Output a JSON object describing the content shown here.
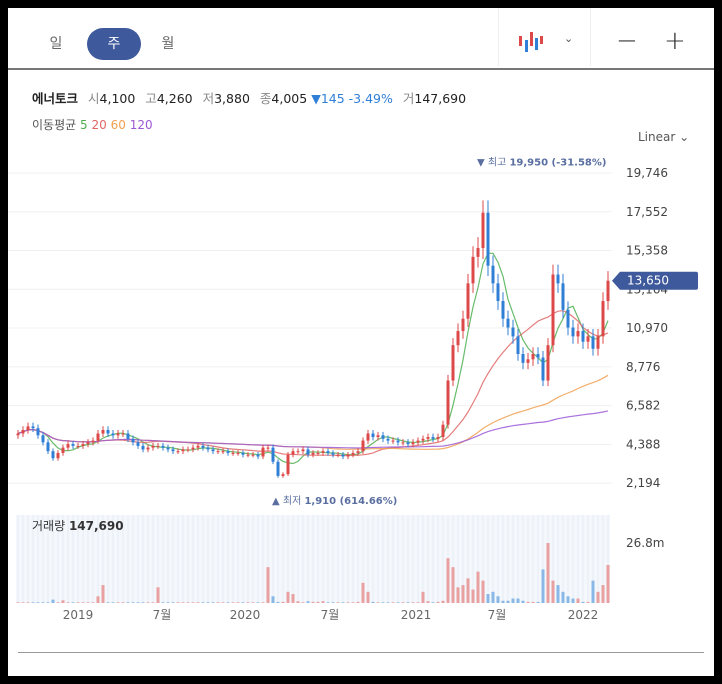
{
  "toolbar": {
    "periods": [
      "일",
      "주",
      "월"
    ],
    "active_period": "주",
    "chart_type_icon": "candlestick-icon",
    "zoom_out": "−",
    "zoom_in": "+"
  },
  "stock": {
    "name": "에너토크",
    "open_label": "시",
    "open": "4,100",
    "high_label": "고",
    "high": "4,260",
    "low_label": "저",
    "low": "3,880",
    "close_label": "종",
    "close": "4,005",
    "change_arrow": "▼",
    "change": "145",
    "change_pct": "-3.49%",
    "volume_label": "거",
    "volume": "147,690"
  },
  "moving_avg": {
    "label": "이동평균",
    "periods": [
      "5",
      "20",
      "60",
      "120"
    ],
    "colors": [
      "#4caf50",
      "#e06666",
      "#f0a050",
      "#9b59d6"
    ]
  },
  "scale_mode": "Linear",
  "colors": {
    "up": "#dd4848",
    "down": "#2f7fd6",
    "up_volume": "#e8a0a0",
    "down_volume": "#8ab8e6",
    "price_tag": "#3f5a9c",
    "annotation": "#5a6fa0"
  },
  "chart_data": {
    "type": "candlestick",
    "price_ticks": [
      "19,746",
      "17,552",
      "15,358",
      "13,164",
      "10,970",
      "8,776",
      "6,582",
      "4,388",
      "2,194"
    ],
    "price_tick_values": [
      19746,
      17552,
      15358,
      13164,
      10970,
      8776,
      6582,
      4388,
      2194
    ],
    "ylim": [
      670,
      21050
    ],
    "current_price": "13,650",
    "max_annotation": {
      "marker": "▼",
      "label": "최고",
      "value": "19,950 (-31.58%)",
      "price": 19950,
      "index": 93
    },
    "min_annotation": {
      "marker": "▲",
      "label": "최저",
      "value": "1,910 (614.66%)",
      "price": 1910,
      "index": 52
    },
    "x_ticks": [
      {
        "label": "2019",
        "index": 12
      },
      {
        "label": "7월",
        "index": 28.8
      },
      {
        "label": "2020",
        "index": 45.4
      },
      {
        "label": "7월",
        "index": 62.4
      },
      {
        "label": "2021",
        "index": 79.6
      },
      {
        "label": "7월",
        "index": 95.8
      },
      {
        "label": "2022",
        "index": 113
      }
    ],
    "closes": [
      5000,
      5200,
      5400,
      5300,
      4900,
      4500,
      4000,
      3600,
      3900,
      4200,
      4400,
      4300,
      4300,
      4400,
      4500,
      4600,
      5000,
      5200,
      5000,
      4900,
      5000,
      5000,
      4700,
      4500,
      4300,
      4100,
      4200,
      4300,
      4300,
      4200,
      4100,
      4000,
      4000,
      4100,
      4100,
      4200,
      4300,
      4200,
      4100,
      4000,
      4000,
      4000,
      3900,
      3900,
      3900,
      3800,
      3800,
      3800,
      3700,
      4200,
      4200,
      3400,
      2600,
      2700,
      3800,
      4000,
      4000,
      4100,
      3800,
      3900,
      3900,
      4000,
      3900,
      3800,
      3800,
      3700,
      3800,
      3900,
      4000,
      4600,
      5000,
      4800,
      4900,
      4700,
      4600,
      4600,
      4500,
      4500,
      4400,
      4500,
      4600,
      4700,
      4800,
      4700,
      4800,
      5500,
      8000,
      10000,
      10800,
      11500,
      13500,
      15000,
      15500,
      17500,
      14500,
      13500,
      12500,
      11500,
      11000,
      10500,
      9500,
      9000,
      9200,
      9500,
      9300,
      8000,
      10000,
      14000,
      13500,
      12000,
      11000,
      10500,
      10800,
      10200,
      10500,
      9800,
      10500,
      12500,
      13650
    ],
    "volume": {
      "label": "거래량",
      "value": "147,690",
      "tick": "26.8m",
      "max": 39.3,
      "values_m": [
        0.3,
        0.3,
        0.3,
        0.3,
        0.3,
        0.3,
        0.3,
        1.5,
        0.3,
        1.2,
        0.3,
        0.3,
        0.3,
        0.3,
        0.3,
        0.3,
        3,
        8,
        0.3,
        0.3,
        0.3,
        0.3,
        0.3,
        0.3,
        0.3,
        0.3,
        0.3,
        0.3,
        7,
        0.3,
        0.3,
        0.3,
        0.3,
        0.3,
        0.3,
        0.3,
        0.3,
        0.3,
        0.3,
        0.3,
        0.3,
        0.3,
        0.3,
        0.3,
        0.3,
        0.3,
        0.3,
        0.3,
        0.3,
        0.3,
        16,
        3,
        0.5,
        0.5,
        5,
        4,
        0.8,
        0.3,
        0.8,
        0.5,
        0.5,
        0.8,
        0.3,
        0.3,
        0.3,
        0.3,
        0.3,
        0.3,
        0.5,
        9,
        5,
        0.5,
        0.3,
        0.3,
        0.3,
        0.3,
        0.3,
        0.3,
        0.3,
        0.3,
        0.3,
        5,
        0.8,
        0.3,
        0.5,
        1,
        20,
        16,
        7,
        8,
        11,
        6,
        14,
        10,
        4,
        5,
        3,
        1,
        1,
        2,
        2,
        1,
        0.5,
        0.5,
        0.5,
        15,
        26.8,
        10,
        8,
        5,
        3,
        2,
        2,
        0.5,
        0.5,
        10,
        5,
        8,
        17,
        12
      ]
    }
  }
}
